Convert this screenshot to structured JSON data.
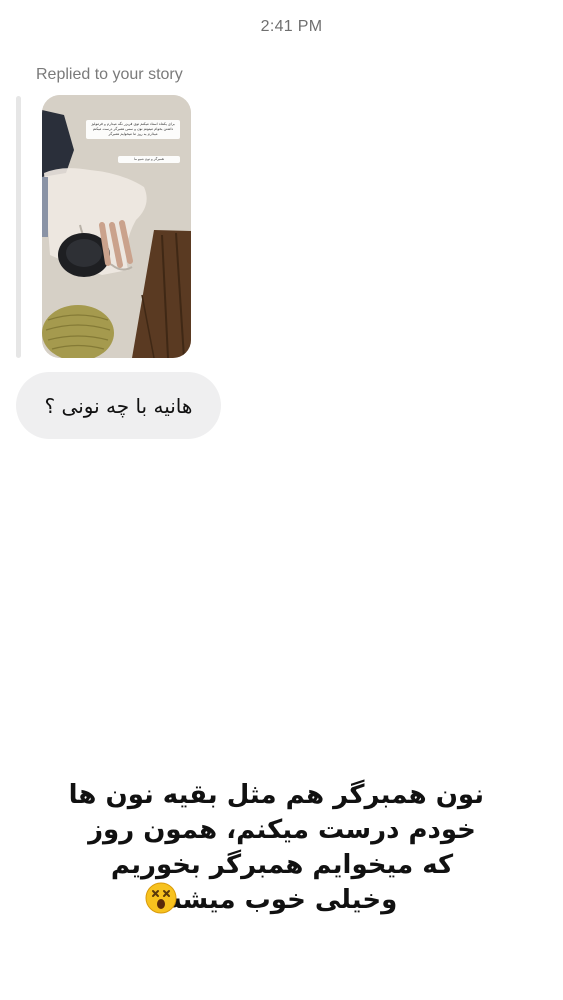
{
  "header": {
    "timestamp": "2:41 PM"
  },
  "reply": {
    "label": "Replied to your story"
  },
  "story": {
    "caption": "برای یکماه استاد میکنم توی فریزر نگه میدارم و فرمولیژ داشتن بخوام میتونم نون و سس همبرگر درست میکنم میذارم یه روز ما میخوایم همبرگر",
    "caption2": "همبرگر و نون شبو ما"
  },
  "message": {
    "text": "هانیه با چه نونی ؟"
  },
  "overlay": {
    "lines": [
      "نون همبرگر هم مثل بقیه نون ها",
      "خودم درست میکنم، همون روز",
      "که میخوایم همبرگر بخوریم",
      "وخیلی خوب میشه"
    ],
    "emoji": "astonished-face-icon"
  }
}
